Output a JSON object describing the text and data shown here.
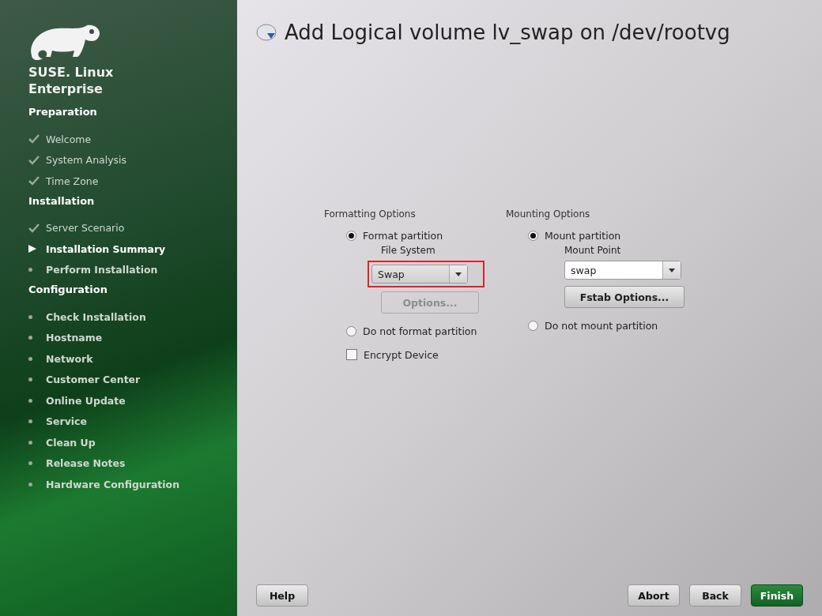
{
  "brand": {
    "line_1": "SUSE. Linux",
    "line_2": "Enterprise"
  },
  "sidebar": {
    "sections": [
      {
        "title": "Preparation",
        "items": [
          {
            "label": "Welcome",
            "kind": "done"
          },
          {
            "label": "System Analysis",
            "kind": "done"
          },
          {
            "label": "Time Zone",
            "kind": "done"
          }
        ]
      },
      {
        "title": "Installation",
        "items": [
          {
            "label": "Server Scenario",
            "kind": "done"
          },
          {
            "label": "Installation Summary",
            "kind": "current"
          },
          {
            "label": "Perform Installation",
            "kind": "pending"
          }
        ]
      },
      {
        "title": "Configuration",
        "items": [
          {
            "label": "Check Installation",
            "kind": "pending"
          },
          {
            "label": "Hostname",
            "kind": "pending"
          },
          {
            "label": "Network",
            "kind": "pending"
          },
          {
            "label": "Customer Center",
            "kind": "pending"
          },
          {
            "label": "Online Update",
            "kind": "pending"
          },
          {
            "label": "Service",
            "kind": "pending"
          },
          {
            "label": "Clean Up",
            "kind": "pending"
          },
          {
            "label": "Release Notes",
            "kind": "pending"
          },
          {
            "label": "Hardware Configuration",
            "kind": "pending"
          }
        ]
      }
    ]
  },
  "dialog": {
    "title": "Add Logical volume lv_swap on /dev/rootvg",
    "formatting": {
      "heading": "Formatting Options",
      "format_option": {
        "label": "Format partition",
        "selected": true
      },
      "file_system": {
        "label": "File System",
        "value": "Swap",
        "highlighted": true
      },
      "options_button": {
        "label": "Options...",
        "disabled": true
      },
      "no_format_option": {
        "label": "Do not format partition",
        "selected": false
      },
      "encrypt": {
        "label": "Encrypt Device",
        "checked": false
      }
    },
    "mounting": {
      "heading": "Mounting Options",
      "mount_option": {
        "label": "Mount partition",
        "selected": true
      },
      "mount_point": {
        "label": "Mount Point",
        "value": "swap"
      },
      "fstab_button": {
        "label": "Fstab Options...",
        "disabled": false
      },
      "no_mount_option": {
        "label": "Do not mount partition",
        "selected": false
      }
    }
  },
  "buttons": [
    {
      "label": "Help",
      "kind": "normal"
    },
    {
      "label": "Abort",
      "kind": "normal"
    },
    {
      "label": "Back",
      "kind": "normal"
    },
    {
      "label": "Finish",
      "kind": "primary"
    }
  ]
}
